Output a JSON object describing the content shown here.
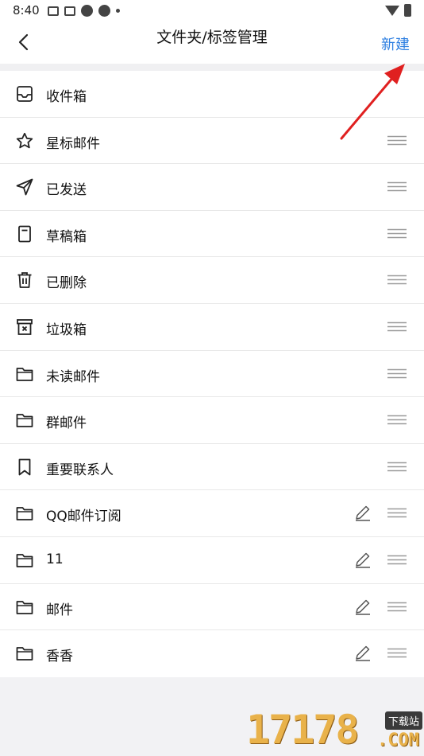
{
  "status": {
    "time": "8:40"
  },
  "header": {
    "title": "文件夹/标签管理",
    "new_label": "新建"
  },
  "colors": {
    "accent": "#2d7fe1",
    "annotation_arrow": "#e02020"
  },
  "folders": [
    {
      "label": "收件箱",
      "icon": "inbox-icon",
      "draggable": false,
      "editable": false
    },
    {
      "label": "星标邮件",
      "icon": "star-icon",
      "draggable": true,
      "editable": false
    },
    {
      "label": "已发送",
      "icon": "send-icon",
      "draggable": true,
      "editable": false
    },
    {
      "label": "草稿箱",
      "icon": "draft-icon",
      "draggable": true,
      "editable": false
    },
    {
      "label": "已删除",
      "icon": "trash-icon",
      "draggable": true,
      "editable": false
    },
    {
      "label": "垃圾箱",
      "icon": "spam-icon",
      "draggable": true,
      "editable": false
    },
    {
      "label": "未读邮件",
      "icon": "folder-icon",
      "draggable": true,
      "editable": false
    },
    {
      "label": "群邮件",
      "icon": "folder-icon",
      "draggable": true,
      "editable": false
    },
    {
      "label": "重要联系人",
      "icon": "bookmark-icon",
      "draggable": true,
      "editable": false
    },
    {
      "label": "QQ邮件订阅",
      "icon": "folder-icon",
      "draggable": true,
      "editable": true
    },
    {
      "label": "11",
      "icon": "folder-icon",
      "draggable": true,
      "editable": true
    },
    {
      "label": "邮件",
      "icon": "folder-icon",
      "draggable": true,
      "editable": true
    },
    {
      "label": "香香",
      "icon": "folder-icon",
      "draggable": true,
      "editable": true
    }
  ],
  "watermark": {
    "digits": "17178",
    "badge": "下载站",
    "suffix": ".COM"
  }
}
